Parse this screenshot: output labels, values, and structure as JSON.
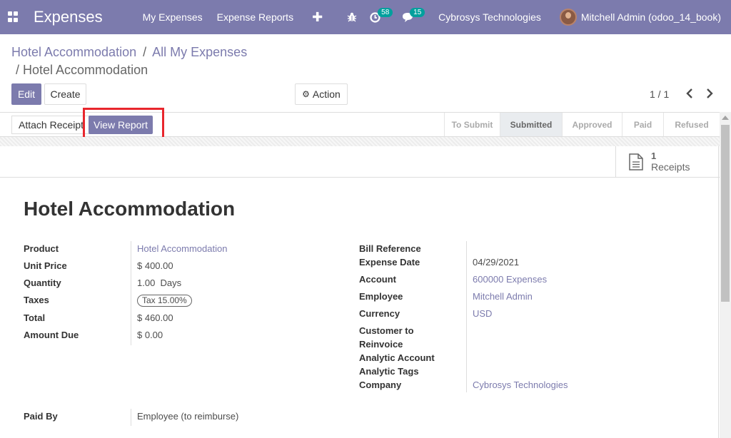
{
  "navbar": {
    "app_name": "Expenses",
    "menu": [
      "My Expenses",
      "Expense Reports"
    ],
    "activity_count": "58",
    "message_count": "15",
    "company": "Cybrosys Technologies",
    "user": "Mitchell Admin (odoo_14_book)"
  },
  "breadcrumb": {
    "items": [
      "Hotel Accommodation",
      "All My Expenses",
      "Hotel Accommodation"
    ]
  },
  "control": {
    "edit_label": "Edit",
    "create_label": "Create",
    "action_label": "Action",
    "pager": "1 / 1"
  },
  "statusbar": {
    "attach_label": "Attach Receipt",
    "view_report_label": "View Report",
    "stages": [
      "To Submit",
      "Submitted",
      "Approved",
      "Paid",
      "Refused"
    ],
    "active_stage": "Submitted"
  },
  "receipts": {
    "count": "1",
    "label": "Receipts"
  },
  "form": {
    "title": "Hotel Accommodation",
    "left_fields": [
      {
        "label": "Product",
        "value": "Hotel Accommodation"
      },
      {
        "label": "Unit Price",
        "value": "$ 400.00"
      },
      {
        "label": "Quantity",
        "value": "1.00  Days"
      },
      {
        "label": "Taxes",
        "value": "Tax 15.00%"
      },
      {
        "label": "Total",
        "value": "$ 460.00"
      },
      {
        "label": "Amount Due",
        "value": "$ 0.00"
      }
    ],
    "right_fields": [
      {
        "label": "Bill Reference",
        "value": ""
      },
      {
        "label": "Expense Date",
        "value": "04/29/2021"
      },
      {
        "label": "Account",
        "value": "600000 Expenses"
      },
      {
        "label": "Employee",
        "value": "Mitchell Admin"
      },
      {
        "label": "Currency",
        "value": "USD"
      },
      {
        "label": "Customer to Reinvoice",
        "value": ""
      },
      {
        "label": "Analytic Account",
        "value": ""
      },
      {
        "label": "Analytic Tags",
        "value": ""
      },
      {
        "label": "Company",
        "value": "Cybrosys Technologies"
      }
    ],
    "paid_by": {
      "label": "Paid By",
      "value": "Employee (to reimburse)"
    }
  },
  "colors": {
    "brand": "#7c7bad",
    "badge": "#00a09d",
    "highlight": "#e8262d"
  }
}
